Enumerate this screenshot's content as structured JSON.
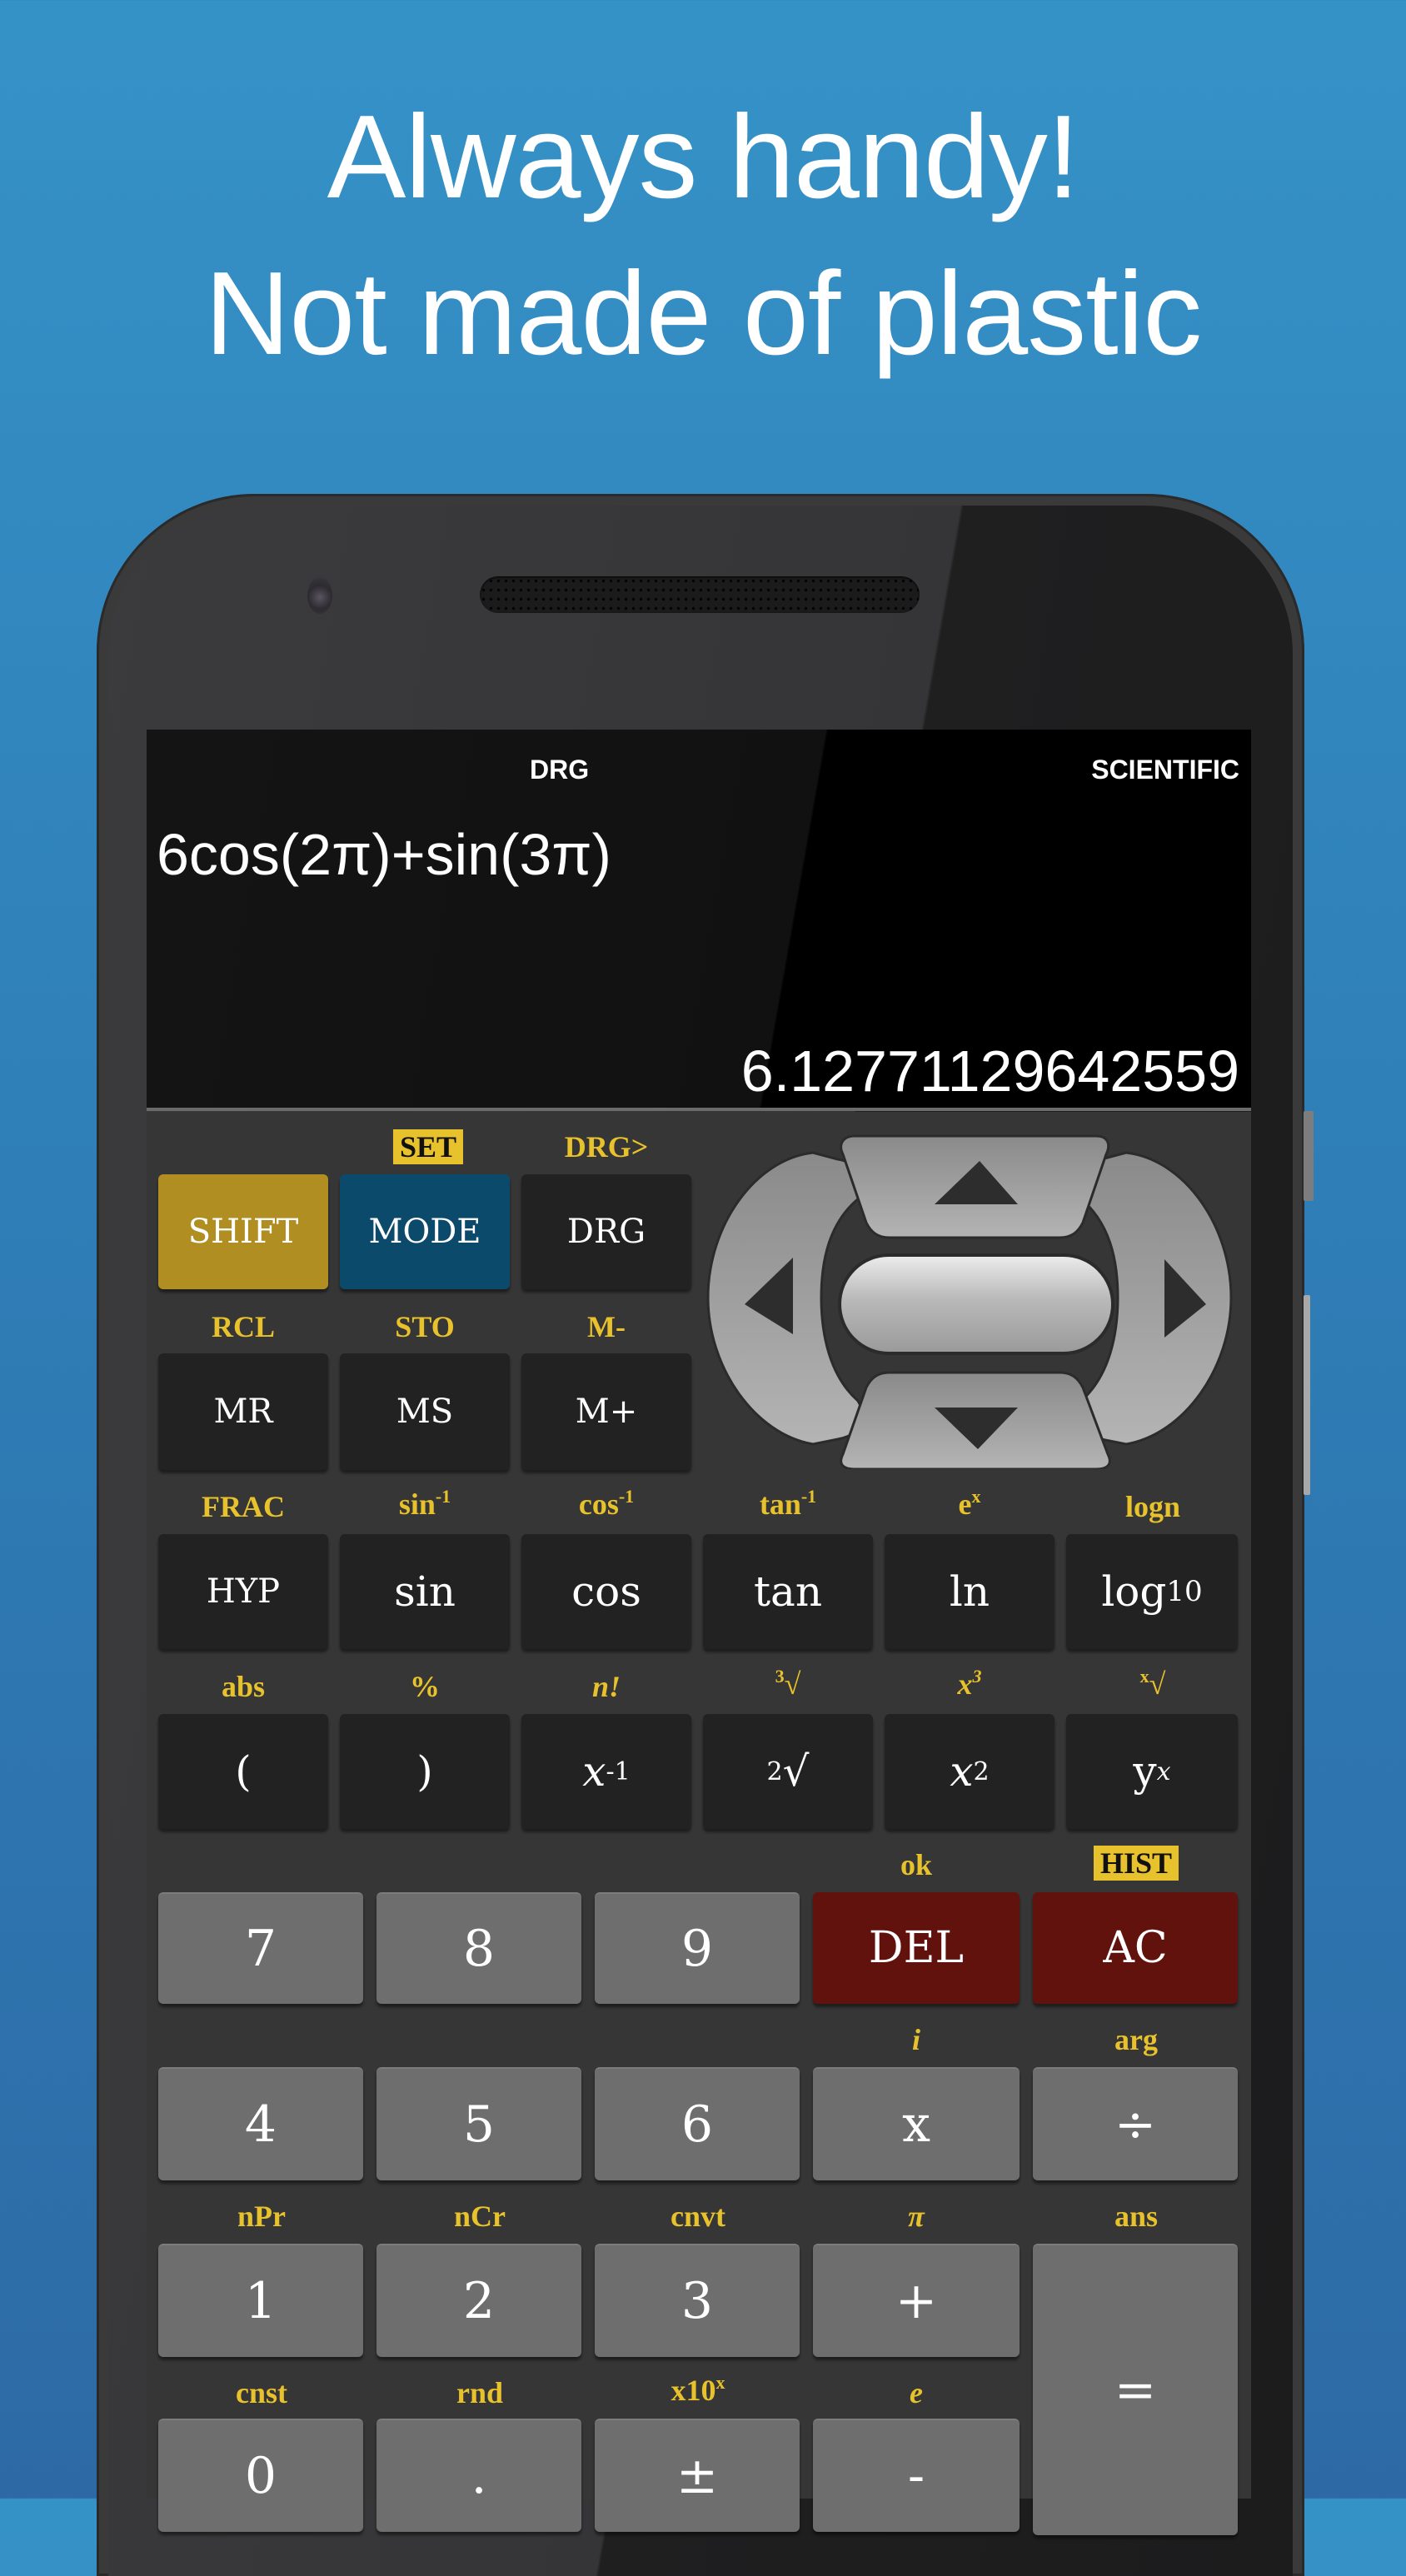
{
  "headline": {
    "line1": "Always handy!",
    "line2": "Not made of plastic"
  },
  "display": {
    "angle_mode": "DRG",
    "calc_mode": "SCIENTIFIC",
    "expression": "6cos(2π)+sin(3π)",
    "result": "6.12771129642559"
  },
  "colors": {
    "background": "#3592c7",
    "shift_key": "#b18e22",
    "mode_key": "#0c4a6c",
    "clear_keys": "#62120d",
    "secondary_label": "#e8c22c",
    "dark_key": "#222222",
    "gray_key": "#6e6e6e"
  },
  "keys": {
    "shift": {
      "label": "SHIFT"
    },
    "mode": {
      "label": "MODE",
      "shift_label": "SET"
    },
    "drg": {
      "label": "DRG",
      "shift_label": "DRG>"
    },
    "mr": {
      "label": "MR",
      "shift_label": "RCL"
    },
    "ms": {
      "label": "MS",
      "shift_label": "STO"
    },
    "mplus": {
      "label": "M+",
      "shift_label": "M-"
    },
    "hyp": {
      "label": "HYP",
      "shift_label": "FRAC"
    },
    "sin": {
      "label": "sin",
      "shift_label": "sin",
      "shift_sup": "-1"
    },
    "cos": {
      "label": "cos",
      "shift_label": "cos",
      "shift_sup": "-1"
    },
    "tan": {
      "label": "tan",
      "shift_label": "tan",
      "shift_sup": "-1"
    },
    "ln": {
      "label": "ln",
      "shift_label": "e",
      "shift_sup": "x"
    },
    "log10": {
      "label": "log",
      "sub": "10",
      "shift_label": "logn"
    },
    "lparen": {
      "label": "(",
      "shift_label": "abs"
    },
    "rparen": {
      "label": ")",
      "shift_label": "%"
    },
    "inverse": {
      "label": "x",
      "sup": "-1",
      "shift_label": "n!"
    },
    "sqrt": {
      "label": "√",
      "pre_sup": "2",
      "shift_label": "√",
      "shift_pre_sup": "3"
    },
    "square": {
      "label": "x",
      "sup": "2",
      "shift_label": "x",
      "shift_sup": "3"
    },
    "power": {
      "label": "y",
      "sup": "x",
      "shift_label": "√",
      "shift_pre_sup": "x"
    },
    "seven": {
      "label": "7"
    },
    "eight": {
      "label": "8"
    },
    "nine": {
      "label": "9"
    },
    "del": {
      "label": "DEL",
      "shift_label": "ok"
    },
    "ac": {
      "label": "AC",
      "shift_label": "HIST"
    },
    "four": {
      "label": "4"
    },
    "five": {
      "label": "5"
    },
    "six": {
      "label": "6"
    },
    "multiply": {
      "label": "x",
      "shift_label": "i"
    },
    "divide": {
      "label": "÷",
      "shift_label": "arg"
    },
    "one": {
      "label": "1",
      "shift_label": "nPr"
    },
    "two": {
      "label": "2",
      "shift_label": "nCr"
    },
    "three": {
      "label": "3",
      "shift_label": "cnvt"
    },
    "plus": {
      "label": "+",
      "shift_label": "π"
    },
    "equals": {
      "label": "=",
      "shift_label": "ans"
    },
    "zero": {
      "label": "0",
      "shift_label": "cnst"
    },
    "dot": {
      "label": ".",
      "shift_label": "rnd"
    },
    "sign": {
      "label": "±",
      "shift_label": "x10",
      "shift_sup": "x"
    },
    "minus": {
      "label": "-",
      "shift_label": "e"
    }
  },
  "dpad": {
    "up": "arrow-up",
    "down": "arrow-down",
    "left": "arrow-left",
    "right": "arrow-right",
    "center": "center-button"
  }
}
